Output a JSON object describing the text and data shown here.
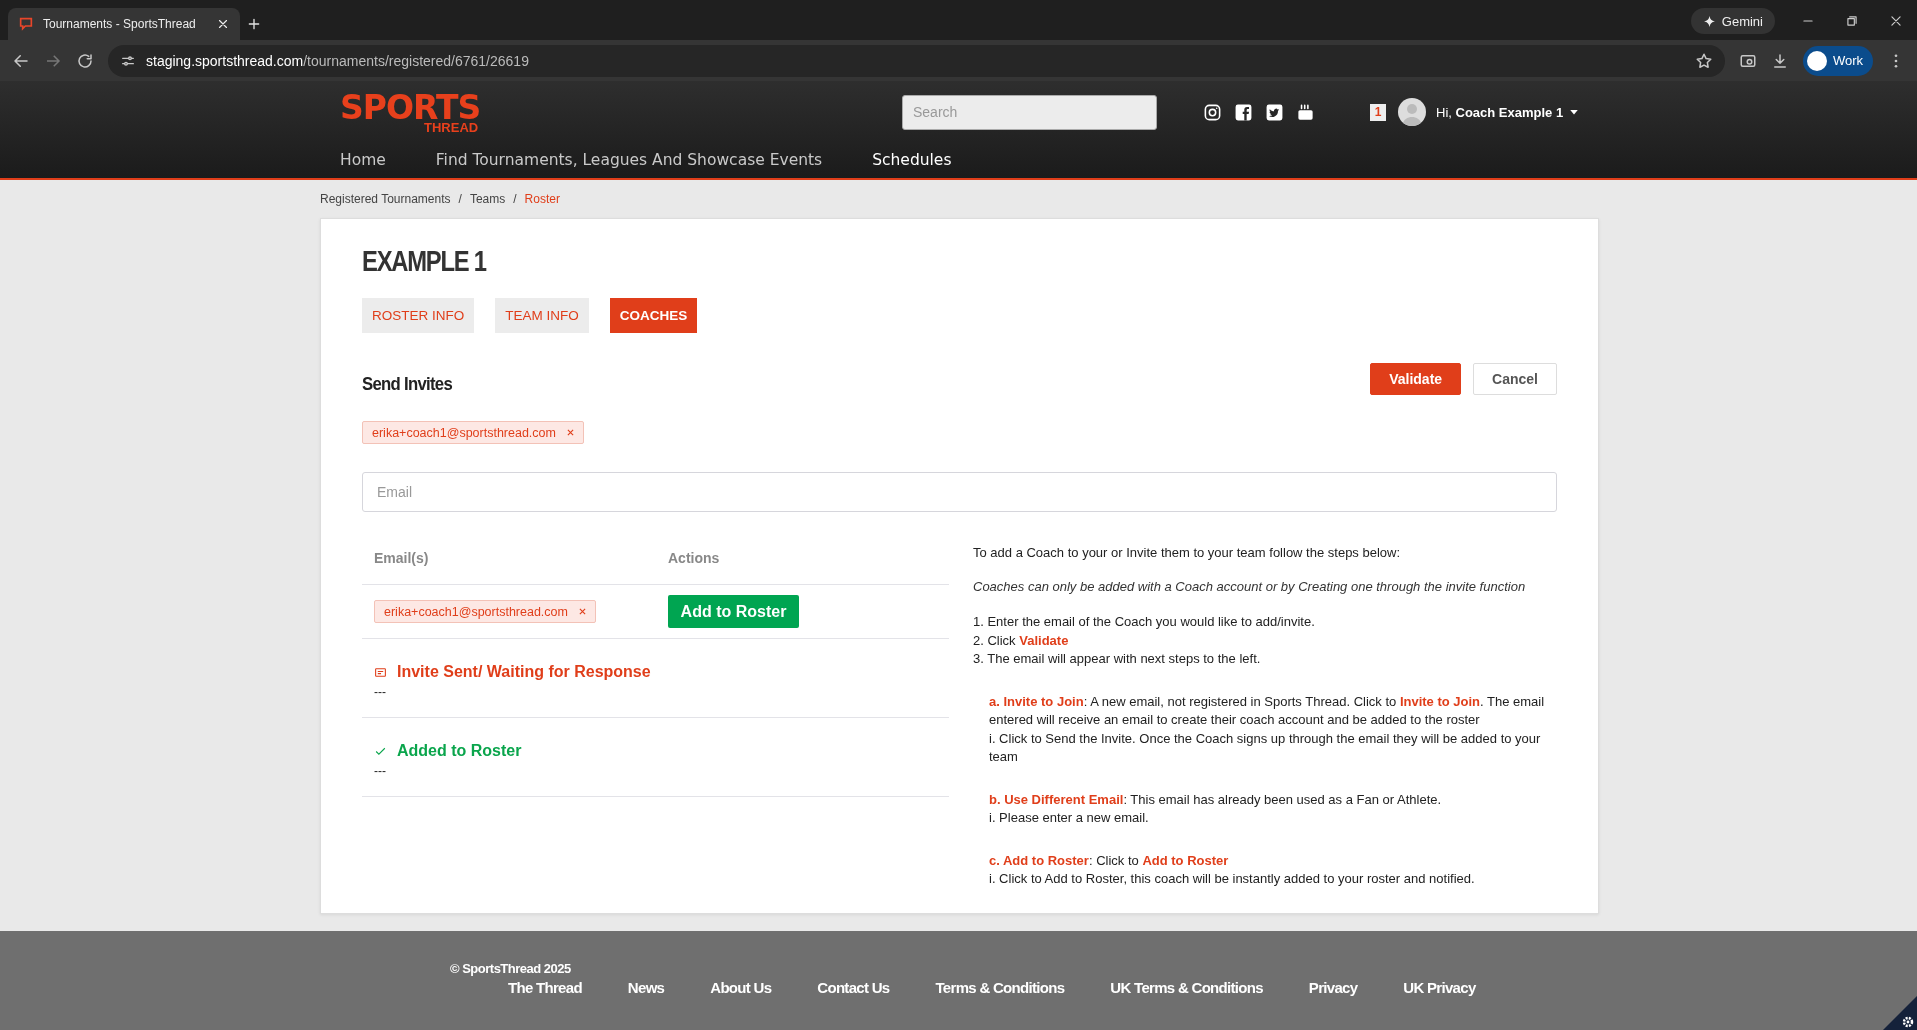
{
  "browser": {
    "tab_title": "Tournaments - SportsThread",
    "url_host": "staging.sportsthread.com",
    "url_path": "/tournaments/registered/6761/26619",
    "gemini": "Gemini",
    "profile": "Work"
  },
  "header": {
    "logo_top": "SPORTS",
    "logo_bottom": "THREAD",
    "search": {
      "placeholder": "Search"
    },
    "notification_count": "1",
    "greeting": "Hi, ",
    "user_name": "Coach Example 1",
    "nav": [
      {
        "label": "Home",
        "selected": false
      },
      {
        "label": "Find Tournaments, Leagues And Showcase Events",
        "selected": false
      },
      {
        "label": "Schedules",
        "selected": true
      }
    ]
  },
  "breadcrumb": [
    {
      "label": "Registered Tournaments",
      "current": false
    },
    {
      "separator_before": "/",
      "label": "Teams",
      "current": false
    },
    {
      "separator_before": "/",
      "label": "Roster",
      "current": true
    }
  ],
  "team_title": "EXAMPLE 1",
  "tabs": [
    {
      "label": "ROSTER INFO",
      "selected": false
    },
    {
      "label": "TEAM INFO",
      "selected": false
    },
    {
      "label": "COACHES",
      "selected": true
    }
  ],
  "send_invites": {
    "title": "Send Invites",
    "buttons": [
      {
        "label": "Validate",
        "kind": "primary"
      },
      {
        "label": "Cancel",
        "kind": "secondary"
      }
    ],
    "chips": [
      "erika+coach1@sportsthread.com"
    ],
    "email_field": {
      "placeholder": "Email"
    }
  },
  "table": {
    "columns": [
      "Email(s)",
      "Actions"
    ],
    "rows": [
      {
        "email": "erika+coach1@sportsthread.com",
        "action": "Add to Roster"
      }
    ]
  },
  "statuses": [
    {
      "kind": "pending",
      "label": "Invite Sent/ Waiting for Response",
      "value": "---"
    },
    {
      "kind": "added",
      "label": "Added to Roster",
      "value": "---"
    }
  ],
  "instructions": {
    "intro": "To add a Coach to your or Invite them to your team follow the steps below:",
    "note": "Coaches can only be added with a Coach account or by Creating one through the invite function",
    "steps": [
      "1. Enter the email of the Coach you would like to add/invite.",
      "2. Click **Validate**",
      "3. The email will appear with next steps to the left."
    ],
    "options": [
      {
        "text": "**a. Invite to Join**: A new email, not registered in Sports Thread. Click to **Invite to Join**. The email entered will receive an email to create their coach account and be added to the roster",
        "sub": "i. Click to Send the Invite. Once the Coach signs up through the email they will be added to your team"
      },
      {
        "text": "**b. Use Different Email**: This email has already been used as a Fan or Athlete.",
        "sub": "i. Please enter a new email."
      },
      {
        "text": "**c. Add to Roster**: Click to **Add to Roster**",
        "sub": "i. Click to Add to Roster, this coach will be instantly added to your roster and notified."
      }
    ]
  },
  "footer": {
    "copyright": "© SportsThread 2025",
    "links": [
      "The Thread",
      "News",
      "About Us",
      "Contact Us",
      "Terms & Conditions",
      "UK Terms & Conditions",
      "Privacy",
      "UK Privacy"
    ]
  }
}
